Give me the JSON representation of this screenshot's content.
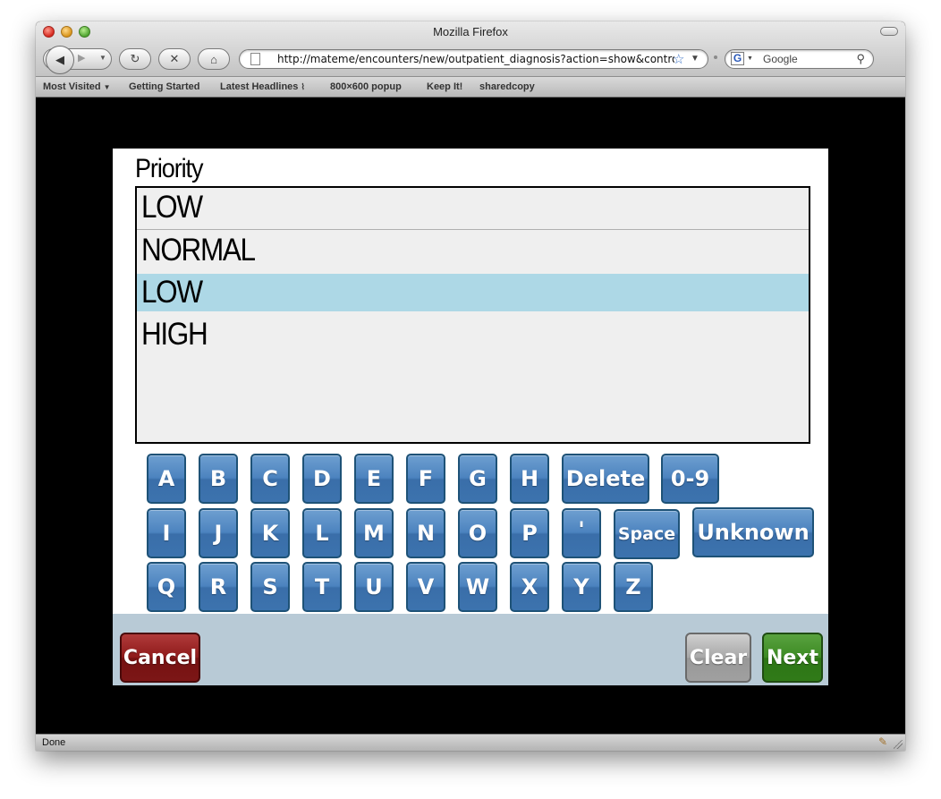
{
  "browser": {
    "title": "Mozilla Firefox",
    "url": "http://mateme/encounters/new/outpatient_diagnosis?action=show&controller",
    "search_placeholder": "Google",
    "search_engine_icon": "G",
    "status": "Done",
    "bookmarks": [
      "Most Visited",
      "Getting Started",
      "Latest Headlines",
      "800×600 popup",
      "Keep It!",
      "sharedcopy"
    ]
  },
  "form": {
    "label": "Priority",
    "options": [
      "LOW",
      "NORMAL",
      "LOW",
      "HIGH"
    ],
    "selected_index": 2
  },
  "keyboard": {
    "row1": [
      "A",
      "B",
      "C",
      "D",
      "E",
      "F",
      "G",
      "H",
      "Delete",
      "0-9"
    ],
    "row2": [
      "I",
      "J",
      "K",
      "L",
      "M",
      "N",
      "O",
      "P",
      "'",
      "Space",
      "Unknown"
    ],
    "row3": [
      "Q",
      "R",
      "S",
      "T",
      "U",
      "V",
      "W",
      "X",
      "Y",
      "Z"
    ]
  },
  "buttons": {
    "cancel": "Cancel",
    "clear": "Clear",
    "next": "Next"
  },
  "colors": {
    "selected_row": "#add8e6",
    "key_blue": "#4c83bf",
    "cancel_red": "#8e1a1a",
    "next_green": "#3c8a23",
    "button_bar": "#b8cad6"
  }
}
